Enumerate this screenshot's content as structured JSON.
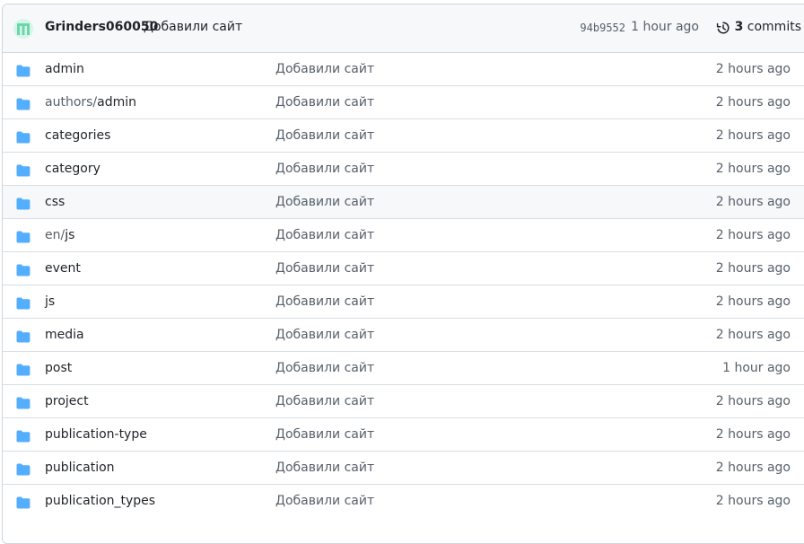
{
  "commit": {
    "author": "Grinders060050",
    "message": "Добавили сайт",
    "sha": "94b9552",
    "time": "1 hour ago",
    "commits_count": "3",
    "commits_label": "commits"
  },
  "rows": [
    {
      "prefix": "",
      "name": "admin",
      "message": "Добавили сайт",
      "age": "2 hours ago"
    },
    {
      "prefix": "authors/",
      "name": "admin",
      "message": "Добавили сайт",
      "age": "2 hours ago"
    },
    {
      "prefix": "",
      "name": "categories",
      "message": "Добавили сайт",
      "age": "2 hours ago"
    },
    {
      "prefix": "",
      "name": "category",
      "message": "Добавили сайт",
      "age": "2 hours ago"
    },
    {
      "prefix": "",
      "name": "css",
      "message": "Добавили сайт",
      "age": "2 hours ago"
    },
    {
      "prefix": "en/",
      "name": "js",
      "message": "Добавили сайт",
      "age": "2 hours ago"
    },
    {
      "prefix": "",
      "name": "event",
      "message": "Добавили сайт",
      "age": "2 hours ago"
    },
    {
      "prefix": "",
      "name": "js",
      "message": "Добавили сайт",
      "age": "2 hours ago"
    },
    {
      "prefix": "",
      "name": "media",
      "message": "Добавили сайт",
      "age": "2 hours ago"
    },
    {
      "prefix": "",
      "name": "post",
      "message": "Добавили сайт",
      "age": "1 hour ago"
    },
    {
      "prefix": "",
      "name": "project",
      "message": "Добавили сайт",
      "age": "2 hours ago"
    },
    {
      "prefix": "",
      "name": "publication-type",
      "message": "Добавили сайт",
      "age": "2 hours ago"
    },
    {
      "prefix": "",
      "name": "publication",
      "message": "Добавили сайт",
      "age": "2 hours ago"
    },
    {
      "prefix": "",
      "name": "publication_types",
      "message": "Добавили сайт",
      "age": "2 hours ago"
    }
  ],
  "icons": {
    "row_icon": "folder-icon",
    "history_icon": "history-icon"
  },
  "colors": {
    "folder": "#54aeff",
    "header_bg": "#f6f8fa",
    "border": "#d0d7de",
    "avatar": "#6cd6a9"
  }
}
